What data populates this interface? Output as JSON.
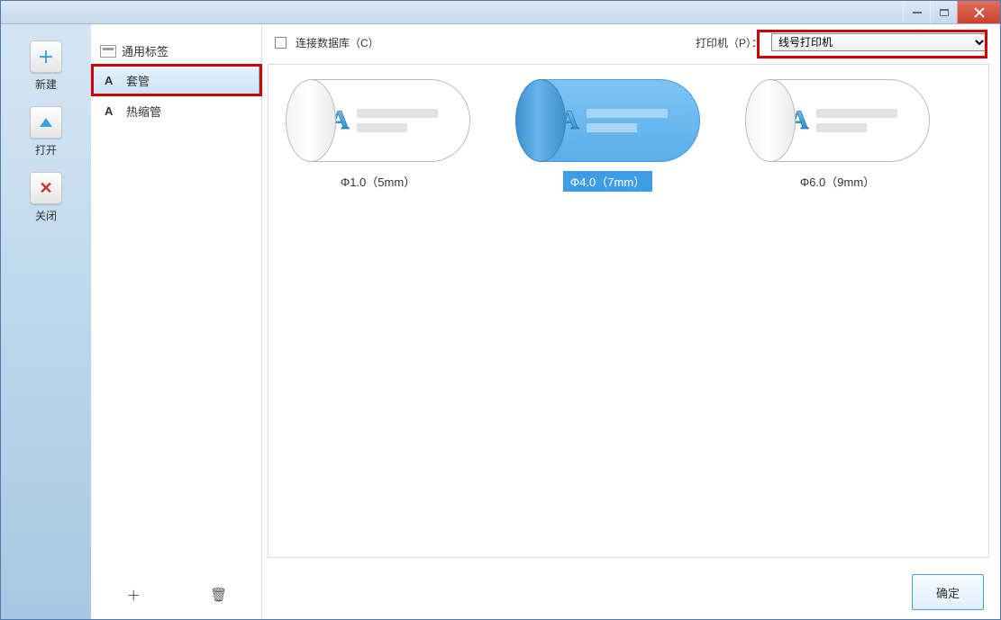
{
  "titlebar": {
    "minimize": "–",
    "maximize": "❐",
    "close": "✕"
  },
  "strip": {
    "new": {
      "label": "新建"
    },
    "open": {
      "label": "打开"
    },
    "close": {
      "label": "关闭"
    }
  },
  "cats": {
    "header": "通用标签",
    "items": [
      {
        "glyph": "A",
        "label": "套管",
        "selected": true
      },
      {
        "glyph": "A",
        "label": "热缩管",
        "selected": false
      }
    ],
    "add_icon": "＋",
    "del_icon": "🗑"
  },
  "toolbar": {
    "db_label": "连接数据库（C）",
    "printer_label": "打印机（P）：",
    "printer_value": "线号打印机"
  },
  "gallery": {
    "items": [
      {
        "label": "Φ1.0（5mm）",
        "selected": false
      },
      {
        "label": "Φ4.0（7mm）",
        "selected": true
      },
      {
        "label": "Φ6.0（9mm）",
        "selected": false
      }
    ]
  },
  "footer": {
    "confirm": "确定"
  }
}
